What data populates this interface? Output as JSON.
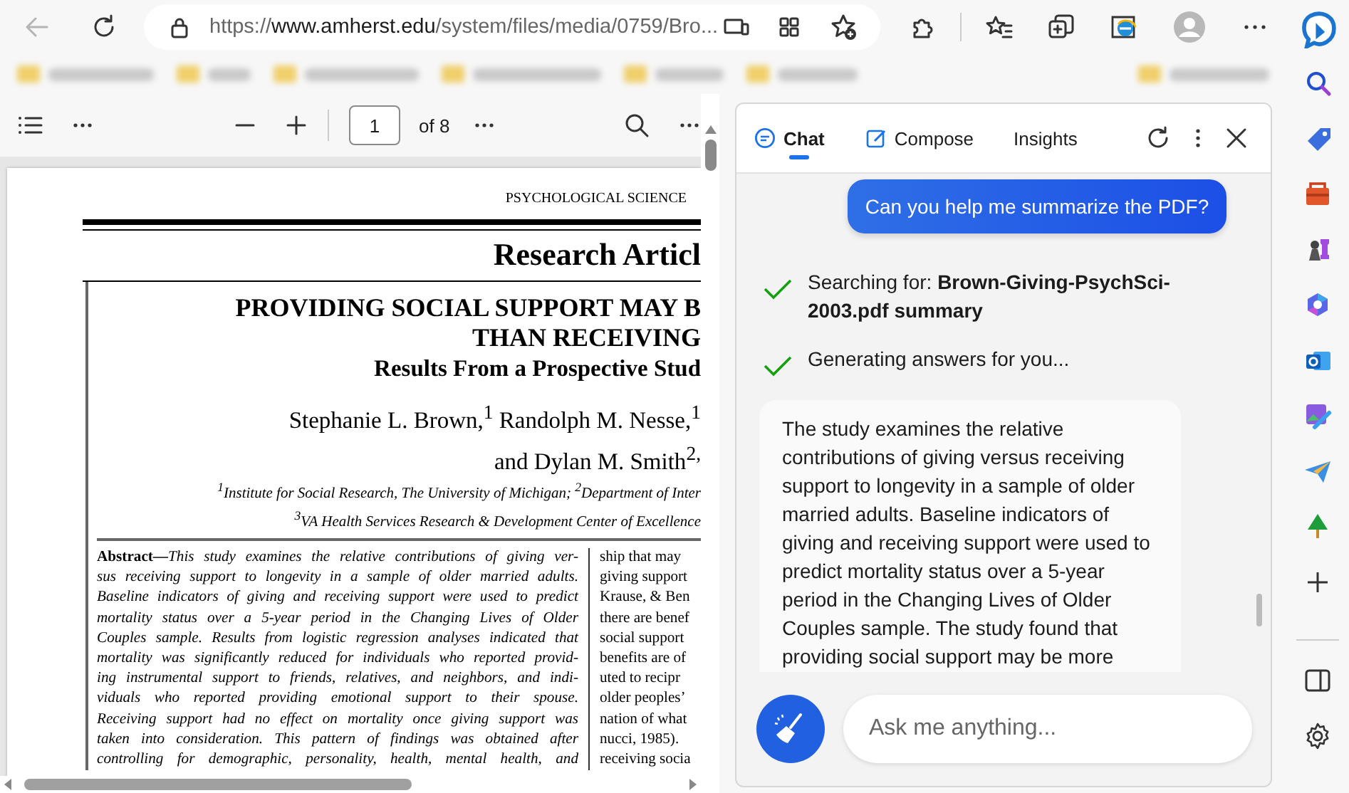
{
  "browser": {
    "back_disabled": true,
    "url": {
      "scheme": "https://",
      "host": "www.amherst.edu",
      "path": "/system/files/media/0759/Bro..."
    }
  },
  "bookmarks_bar": {
    "blurred": true,
    "items": [
      {
        "kind": "folder"
      },
      {
        "kind": "folder"
      },
      {
        "kind": "folder"
      },
      {
        "kind": "folder"
      },
      {
        "kind": "folder"
      },
      {
        "kind": "folder"
      },
      {
        "kind": "folder"
      }
    ]
  },
  "pdf_toolbar": {
    "page": "1",
    "page_count": "of 8"
  },
  "document": {
    "journal": "PSYCHOLOGICAL SCIENCE",
    "section": "Research Articl",
    "title_lines": [
      "PROVIDING SOCIAL SUPPORT MAY B",
      "THAN RECEIVING"
    ],
    "subtitle": "Results From a Prospective Stud",
    "author_lines": [
      "Stephanie L. Brown,$^{1}$ Randolph M. Nesse,$^{1}$",
      "and Dylan M. Smith$^{2,}$"
    ],
    "affiliation_lines": [
      "$^{1}$Institute for Social Research, The University of Michigan; $^{2}$Department of Inter",
      "$^{3}$VA Health Services Research & Development Center of Excellence"
    ],
    "abstract": {
      "label": "Abstract—",
      "text": "This study examines the relative contributions of giving ver-\nsus receiving support to longevity in a sample of older married adults.\nBaseline indicators of giving and receiving support were used to predict\nmortality status over a 5-year period in the Changing Lives of Older\nCouples sample. Results from logistic regression analyses indicated that\nmortality was significantly reduced for individuals who reported provid-\ning instrumental support to friends, relatives, and neighbors, and indi-\nviduals who reported providing emotional support to their spouse.\nReceiving support had no effect on mortality once giving support was\ntaken into consideration. This pattern of findings was obtained after\ncontrolling for demographic, personality, health, mental health, and"
    },
    "column_2": "ship that may\ngiving support\nKrause, & Ben\nthere are benef\nsocial support\nbenefits are of\nuted to recipr\nolder peoples’\nnation of what\nnucci, 1985).\nreceiving socia"
  },
  "chat": {
    "tabs": [
      {
        "kind": "chat",
        "label": "Chat",
        "selected": true
      },
      {
        "kind": "compose",
        "label": "Compose",
        "selected": false
      },
      {
        "kind": "insights",
        "label": "Insights",
        "selected": false
      }
    ],
    "user_message": "Can you help me summarize the PDF?",
    "steps": [
      {
        "text": "Searching for: **Brown-Giving-PsychSci-2003.pdf summary**",
        "done": true
      },
      {
        "text": "Generating answers for you...",
        "done": true
      }
    ],
    "answer": "The study examines the relative contributions of giving versus receiving support to longevity in a sample of older married adults. Baseline indicators of giving and receiving support were used to predict mortality status over a 5-year period in the Changing Lives of Older Couples sample. The study found that providing social support may be more",
    "input": {
      "placeholder": "Ask me anything..."
    }
  }
}
